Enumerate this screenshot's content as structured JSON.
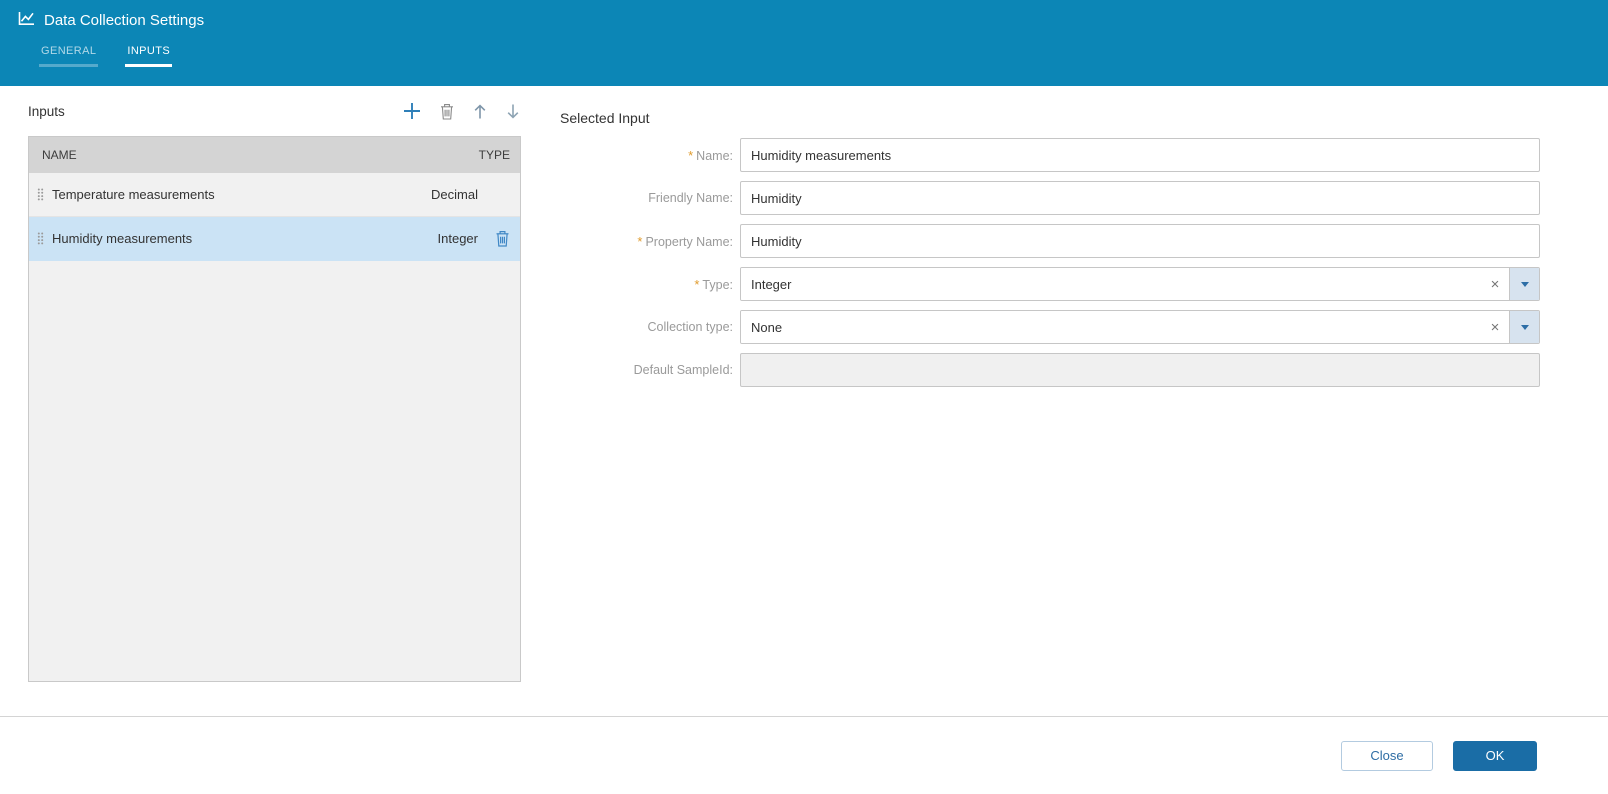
{
  "colors": {
    "header_bg": "#0c86b6",
    "selected_row_bg": "#cbe3f5",
    "primary_button_bg": "#1a6da6",
    "required_marker_color": "#e09b2d",
    "accent_blue": "#2e6da4"
  },
  "header": {
    "title": "Data Collection Settings",
    "tabs": [
      {
        "label": "GENERAL",
        "active": false
      },
      {
        "label": "INPUTS",
        "active": true
      }
    ]
  },
  "inputs_panel": {
    "title": "Inputs",
    "columns": {
      "name": "NAME",
      "type": "TYPE"
    },
    "rows": [
      {
        "name": "Temperature measurements",
        "type": "Decimal",
        "selected": false
      },
      {
        "name": "Humidity measurements",
        "type": "Integer",
        "selected": true
      }
    ]
  },
  "selected_input": {
    "title": "Selected Input",
    "required_marker": "*",
    "clear_glyph": "×",
    "fields": [
      {
        "label": "Name:",
        "required": true,
        "value": "Humidity measurements",
        "control": "text"
      },
      {
        "label": "Friendly Name:",
        "required": false,
        "value": "Humidity",
        "control": "text"
      },
      {
        "label": "Property Name:",
        "required": true,
        "value": "Humidity",
        "control": "text"
      },
      {
        "label": "Type:",
        "required": true,
        "value": "Integer",
        "control": "combobox"
      },
      {
        "label": "Collection type:",
        "required": false,
        "value": "None",
        "control": "combobox"
      },
      {
        "label": "Default SampleId:",
        "required": false,
        "value": "",
        "control": "text",
        "disabled": true
      }
    ]
  },
  "footer": {
    "close_label": "Close",
    "ok_label": "OK"
  }
}
